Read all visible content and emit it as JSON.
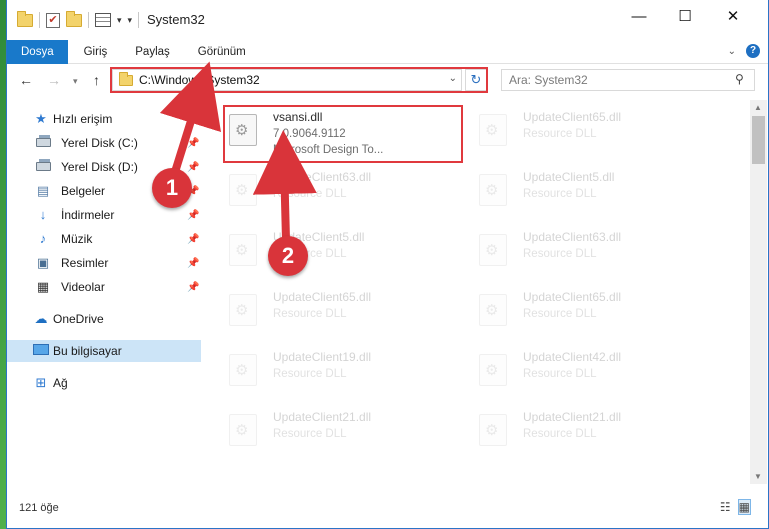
{
  "window": {
    "title": "System32",
    "controls": {
      "minimize": "—",
      "maximize": "☐",
      "close": "✕"
    }
  },
  "ribbon": {
    "tabs": [
      "Dosya",
      "Giriş",
      "Paylaş",
      "Görünüm"
    ],
    "expand_icon": "chevron-down-icon",
    "help": "?"
  },
  "navigation": {
    "address": "C:\\Windows\\System32",
    "search_placeholder": "Ara: System32"
  },
  "sidebar": {
    "quick_access": "Hızlı erişim",
    "items": [
      {
        "label": "Yerel Disk (C:)",
        "icon": "drive-icon",
        "pinned": true
      },
      {
        "label": "Yerel Disk (D:)",
        "icon": "drive-icon",
        "pinned": true
      },
      {
        "label": "Belgeler",
        "icon": "documents-icon",
        "pinned": true
      },
      {
        "label": "İndirmeler",
        "icon": "downloads-icon",
        "pinned": true
      },
      {
        "label": "Müzik",
        "icon": "music-icon",
        "pinned": true
      },
      {
        "label": "Resimler",
        "icon": "pictures-icon",
        "pinned": true
      },
      {
        "label": "Videolar",
        "icon": "videos-icon",
        "pinned": true
      }
    ],
    "onedrive": "OneDrive",
    "this_pc": "Bu bilgisayar",
    "network": "Ağ"
  },
  "files": {
    "highlighted": {
      "name": "vsansi.dll",
      "version": "7.0.9064.9112",
      "description": "Microsoft Design To..."
    },
    "faded": [
      {
        "name": "UpdateClient65.dll",
        "type": "Resource DLL"
      },
      {
        "name": "UpdateClient63.dll",
        "type": "Resource DLL"
      },
      {
        "name": "UpdateClient5.dll",
        "type": "Resource DLL"
      },
      {
        "name": "UpdateClient5.dll",
        "type": "Resource DLL"
      },
      {
        "name": "UpdateClient63.dll",
        "type": "Resource DLL"
      },
      {
        "name": "UpdateClient65.dll",
        "type": "Resource DLL"
      },
      {
        "name": "UpdateClient65.dll",
        "type": "Resource DLL"
      },
      {
        "name": "UpdateClient19.dll",
        "type": "Resource DLL"
      },
      {
        "name": "UpdateClient42.dll",
        "type": "Resource DLL"
      },
      {
        "name": "UpdateClient21.dll",
        "type": "Resource DLL"
      },
      {
        "name": "UpdateClient21.dll",
        "type": "Resource DLL"
      }
    ]
  },
  "status": {
    "item_count": "121 öğe"
  },
  "annotations": {
    "step1": "1",
    "step2": "2",
    "accent": "#e0393e"
  }
}
